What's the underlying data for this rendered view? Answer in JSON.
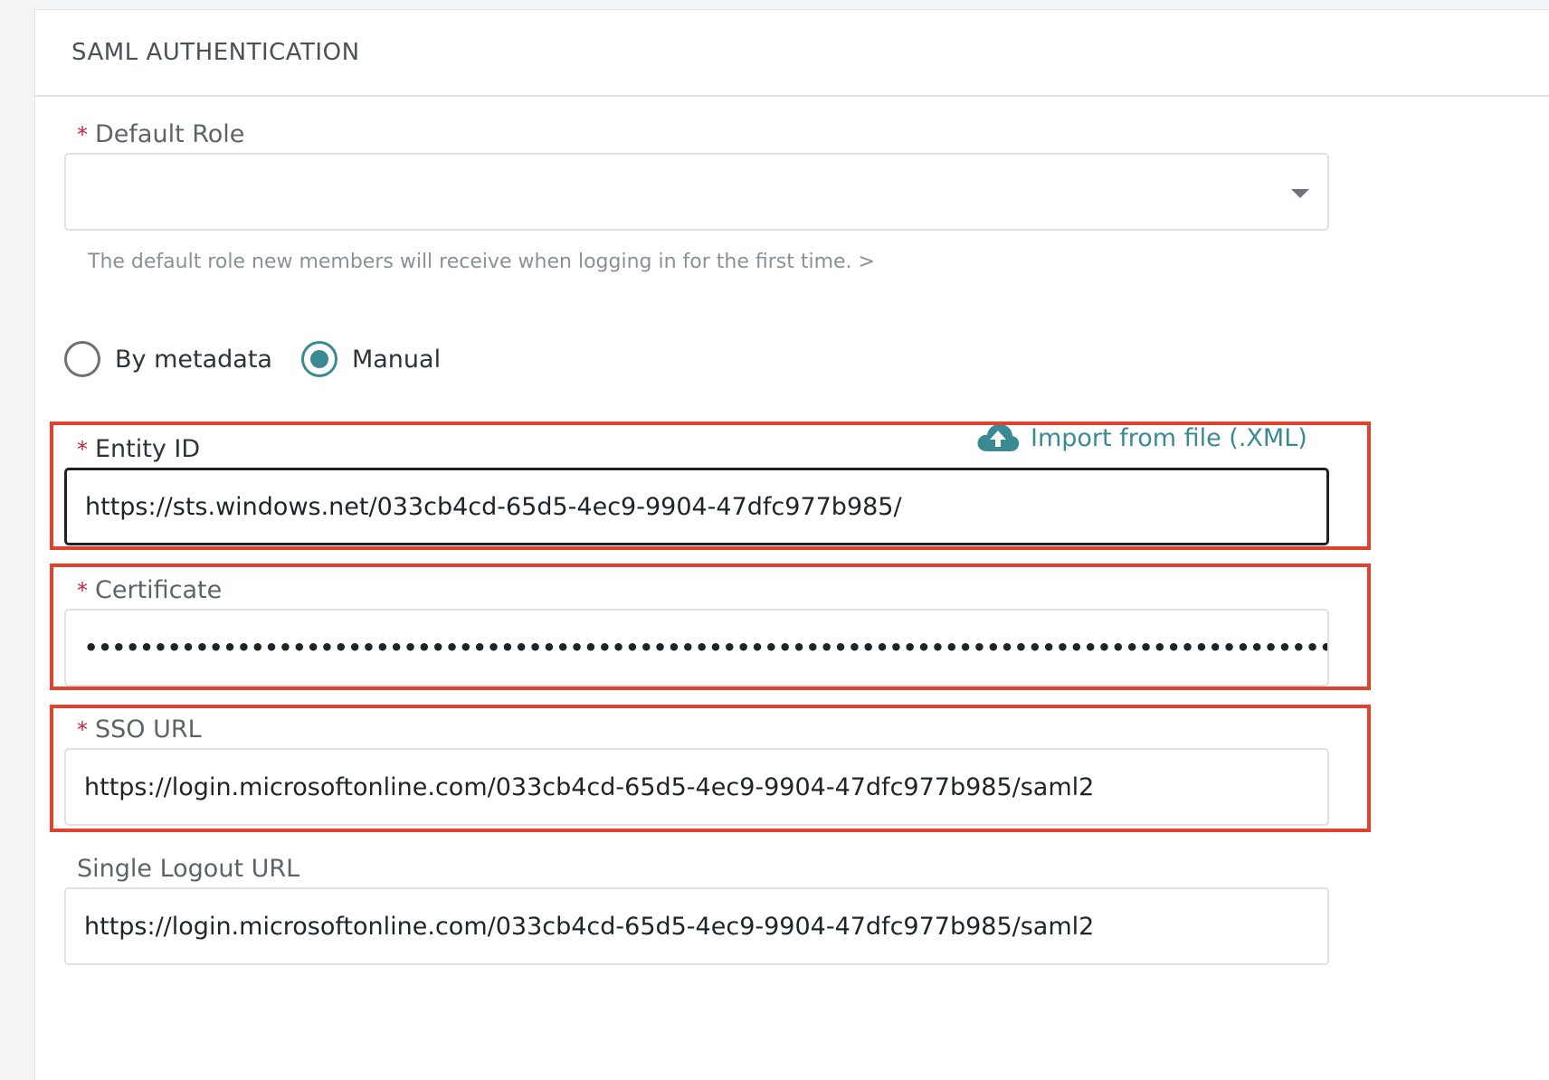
{
  "header": {
    "title": "SAML AUTHENTICATION"
  },
  "default_role": {
    "label": "Default Role",
    "required_mark": "*",
    "value": "",
    "helper": "The default role new members will receive when logging in for the first time. >",
    "icon": "caret-down-icon"
  },
  "config_mode": {
    "options": [
      {
        "label": "By metadata",
        "checked": false
      },
      {
        "label": "Manual",
        "checked": true
      }
    ]
  },
  "import": {
    "label": "Import from file (.XML)",
    "icon": "cloud-upload-icon",
    "color": "#3a8a93"
  },
  "entity_id": {
    "label": "Entity ID",
    "required_mark": "*",
    "value": "https://sts.windows.net/033cb4cd-65d5-4ec9-9904-47dfc977b985/"
  },
  "certificate": {
    "label": "Certificate",
    "required_mark": "*",
    "masked_value": "••••••••••••••••••••••••••••••••••••••••••••••••••••••••••••••••••••••••••••••••••••••••••••••••••••••••••••••••••••••••••••••••••"
  },
  "sso_url": {
    "label": "SSO URL",
    "required_mark": "*",
    "value": "https://login.microsoftonline.com/033cb4cd-65d5-4ec9-9904-47dfc977b985/saml2"
  },
  "single_logout_url": {
    "label": "Single Logout URL",
    "value": "https://login.microsoftonline.com/033cb4cd-65d5-4ec9-9904-47dfc977b985/saml2"
  },
  "colors": {
    "accent": "#3a8a93",
    "required": "#c0283a",
    "highlight": "#e2412d"
  }
}
